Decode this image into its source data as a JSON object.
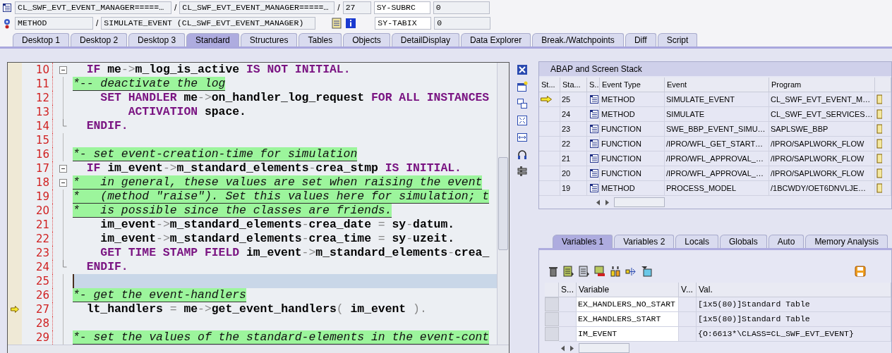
{
  "header": {
    "program": "CL_SWF_EVT_EVENT_MANAGER=====…",
    "separators": [
      "/",
      "/",
      "/"
    ],
    "include": "CL_SWF_EVT_EVENT_MANAGER=====…",
    "line": "27",
    "event_type": "METHOD",
    "event": "SIMULATE_EVENT (CL_SWF_EVT_EVENT_MANAGER)",
    "sysvars": [
      {
        "name": "SY-SUBRC",
        "value": "0"
      },
      {
        "name": "SY-TABIX",
        "value": "0"
      }
    ]
  },
  "tabs": [
    {
      "label": "Desktop 1",
      "selected": false
    },
    {
      "label": "Desktop 2",
      "selected": false
    },
    {
      "label": "Desktop 3",
      "selected": false
    },
    {
      "label": "Standard",
      "selected": true
    },
    {
      "label": "Structures",
      "selected": false
    },
    {
      "label": "Tables",
      "selected": false
    },
    {
      "label": "Objects",
      "selected": false
    },
    {
      "label": "DetailDisplay",
      "selected": false
    },
    {
      "label": "Data Explorer",
      "selected": false
    },
    {
      "label": "Break./Watchpoints",
      "selected": false
    },
    {
      "label": "Diff",
      "selected": false
    },
    {
      "label": "Script",
      "selected": false
    }
  ],
  "code": [
    {
      "number": "10",
      "foldable": true,
      "block_end": false,
      "current": false,
      "breakpoint": false,
      "tokens": [
        {
          "kind": "kw",
          "t": "  IF"
        },
        {
          "kind": "id",
          "t": " me"
        },
        {
          "kind": "op",
          "t": "->"
        },
        {
          "kind": "id",
          "t": "m_log_is_active "
        },
        {
          "kind": "kw",
          "t": "IS NOT INITIAL."
        }
      ]
    },
    {
      "number": "11",
      "foldable": false,
      "block_end": false,
      "current": false,
      "breakpoint": false,
      "tokens": [
        {
          "kind": "comment",
          "t": "*-- deactivate the log"
        }
      ]
    },
    {
      "number": "12",
      "foldable": false,
      "block_end": false,
      "current": false,
      "breakpoint": false,
      "tokens": [
        {
          "kind": "kw",
          "t": "    SET HANDLER"
        },
        {
          "kind": "id",
          "t": " me"
        },
        {
          "kind": "op",
          "t": "->"
        },
        {
          "kind": "id",
          "t": "on_handler_log_request "
        },
        {
          "kind": "kw",
          "t": "FOR ALL INSTANCES"
        }
      ]
    },
    {
      "number": "13",
      "foldable": false,
      "block_end": false,
      "current": false,
      "breakpoint": false,
      "tokens": [
        {
          "kind": "kw",
          "t": "        ACTIVATION"
        },
        {
          "kind": "id",
          "t": " space."
        }
      ]
    },
    {
      "number": "14",
      "foldable": false,
      "block_end": true,
      "current": false,
      "breakpoint": false,
      "tokens": [
        {
          "kind": "kw",
          "t": "  ENDIF."
        }
      ]
    },
    {
      "number": "15",
      "foldable": false,
      "block_end": false,
      "current": false,
      "breakpoint": false
    },
    {
      "number": "16",
      "foldable": false,
      "block_end": false,
      "current": false,
      "breakpoint": false,
      "tokens": [
        {
          "kind": "comment",
          "t": "*- set event-creation-time for simulation"
        }
      ]
    },
    {
      "number": "17",
      "foldable": true,
      "block_end": false,
      "current": false,
      "breakpoint": false,
      "tokens": [
        {
          "kind": "kw",
          "t": "  IF"
        },
        {
          "kind": "id",
          "t": " im_event"
        },
        {
          "kind": "op",
          "t": "->"
        },
        {
          "kind": "id",
          "t": "m_standard_elements"
        },
        {
          "kind": "op",
          "t": "-"
        },
        {
          "kind": "id",
          "t": "crea_stmp "
        },
        {
          "kind": "kw",
          "t": "IS INITIAL."
        }
      ]
    },
    {
      "number": "18",
      "foldable": true,
      "block_end": false,
      "current": false,
      "breakpoint": false,
      "tokens": [
        {
          "kind": "comment",
          "t": "*   in general, these values are set when raising the event"
        }
      ]
    },
    {
      "number": "19",
      "foldable": false,
      "block_end": false,
      "current": false,
      "breakpoint": false,
      "tokens": [
        {
          "kind": "comment",
          "t": "*   (method \"raise\"). Set this values here for simulation; t"
        }
      ]
    },
    {
      "number": "20",
      "foldable": false,
      "block_end": false,
      "current": false,
      "breakpoint": false,
      "tokens": [
        {
          "kind": "comment",
          "t": "*   is possible since the classes are friends."
        }
      ]
    },
    {
      "number": "21",
      "foldable": false,
      "block_end": false,
      "current": false,
      "breakpoint": false,
      "tokens": [
        {
          "kind": "id",
          "t": "    im_event"
        },
        {
          "kind": "op",
          "t": "->"
        },
        {
          "kind": "id",
          "t": "m_standard_elements"
        },
        {
          "kind": "op",
          "t": "-"
        },
        {
          "kind": "id",
          "t": "crea_date "
        },
        {
          "kind": "op",
          "t": "="
        },
        {
          "kind": "id",
          "t": " sy"
        },
        {
          "kind": "op",
          "t": "-"
        },
        {
          "kind": "id",
          "t": "datum."
        }
      ]
    },
    {
      "number": "22",
      "foldable": false,
      "block_end": false,
      "current": false,
      "breakpoint": false,
      "tokens": [
        {
          "kind": "id",
          "t": "    im_event"
        },
        {
          "kind": "op",
          "t": "->"
        },
        {
          "kind": "id",
          "t": "m_standard_elements"
        },
        {
          "kind": "op",
          "t": "-"
        },
        {
          "kind": "id",
          "t": "crea_time "
        },
        {
          "kind": "op",
          "t": "="
        },
        {
          "kind": "id",
          "t": " sy"
        },
        {
          "kind": "op",
          "t": "-"
        },
        {
          "kind": "id",
          "t": "uzeit."
        }
      ]
    },
    {
      "number": "23",
      "foldable": false,
      "block_end": false,
      "current": false,
      "breakpoint": false,
      "tokens": [
        {
          "kind": "kw",
          "t": "    GET TIME STAMP FIELD"
        },
        {
          "kind": "id",
          "t": " im_event"
        },
        {
          "kind": "op",
          "t": "->"
        },
        {
          "kind": "id",
          "t": "m_standard_elements"
        },
        {
          "kind": "op",
          "t": "-"
        },
        {
          "kind": "id",
          "t": "crea_"
        }
      ]
    },
    {
      "number": "24",
      "foldable": false,
      "block_end": true,
      "current": false,
      "breakpoint": false,
      "tokens": [
        {
          "kind": "kw",
          "t": "  ENDIF."
        }
      ]
    },
    {
      "number": "25",
      "foldable": false,
      "block_end": false,
      "current": true,
      "breakpoint": false
    },
    {
      "number": "26",
      "foldable": false,
      "block_end": false,
      "current": false,
      "breakpoint": false,
      "tokens": [
        {
          "kind": "comment",
          "t": "*- get the event-handlers"
        }
      ]
    },
    {
      "number": "27",
      "foldable": false,
      "block_end": false,
      "current": false,
      "breakpoint": true,
      "tokens": [
        {
          "kind": "id",
          "t": "  lt_handlers "
        },
        {
          "kind": "op",
          "t": "="
        },
        {
          "kind": "id",
          "t": " me"
        },
        {
          "kind": "op",
          "t": "->"
        },
        {
          "kind": "id",
          "t": "get_event_handlers"
        },
        {
          "kind": "op",
          "t": "("
        },
        {
          "kind": "id",
          "t": " im_event "
        },
        {
          "kind": "op",
          "t": ")."
        }
      ]
    },
    {
      "number": "28",
      "foldable": false,
      "block_end": false,
      "current": false,
      "breakpoint": false
    },
    {
      "number": "29",
      "foldable": false,
      "block_end": false,
      "current": false,
      "breakpoint": false,
      "tokens": [
        {
          "kind": "comment",
          "t": "*- set the values of the standard-elements in the event-cont"
        }
      ]
    }
  ],
  "stack": {
    "title": "ABAP and Screen Stack",
    "columns": [
      "St...",
      "Sta...",
      "S..",
      "Event Type",
      "Event",
      "Program"
    ],
    "rows": [
      {
        "active": true,
        "level": "25",
        "event_type": "METHOD",
        "event": "SIMULATE_EVENT",
        "program": "CL_SWF_EVT_EVENT_M…"
      },
      {
        "active": false,
        "level": "24",
        "event_type": "METHOD",
        "event": "SIMULATE",
        "program": "CL_SWF_EVT_SERVICES…"
      },
      {
        "active": false,
        "level": "23",
        "event_type": "FUNCTION",
        "event": "SWE_BBP_EVENT_SIMU…",
        "program": "SAPLSWE_BBP"
      },
      {
        "active": false,
        "level": "22",
        "event_type": "FUNCTION",
        "event": "/IPRO/WFL_GET_START…",
        "program": "/IPRO/SAPLWORK_FLOW"
      },
      {
        "active": false,
        "level": "21",
        "event_type": "FUNCTION",
        "event": "/IPRO/WFL_APPROVAL_…",
        "program": "/IPRO/SAPLWORK_FLOW"
      },
      {
        "active": false,
        "level": "20",
        "event_type": "FUNCTION",
        "event": "/IPRO/WFL_APPROVAL_…",
        "program": "/IPRO/SAPLWORK_FLOW"
      },
      {
        "active": false,
        "level": "19",
        "event_type": "METHOD",
        "event": "PROCESS_MODEL",
        "program": "/1BCWDY/OET6DNVLJE…"
      }
    ]
  },
  "var_tabs": [
    {
      "label": "Variables 1",
      "selected": true
    },
    {
      "label": "Variables 2",
      "selected": false
    },
    {
      "label": "Locals",
      "selected": false
    },
    {
      "label": "Globals",
      "selected": false
    },
    {
      "label": "Auto",
      "selected": false
    },
    {
      "label": "Memory Analysis",
      "selected": false
    }
  ],
  "variables": {
    "columns": [
      "S...",
      "Variable",
      "V...",
      "Val."
    ],
    "rows": [
      {
        "variable": "EX_HANDLERS_NO_START",
        "value": "[1x5(80)]Standard Table"
      },
      {
        "variable": "EX_HANDLERS_START",
        "value": "[1x5(80)]Standard Table"
      },
      {
        "variable": "IM_EVENT",
        "value": "{O:6613*\\CLASS=CL_SWF_EVT_EVENT}"
      }
    ]
  }
}
